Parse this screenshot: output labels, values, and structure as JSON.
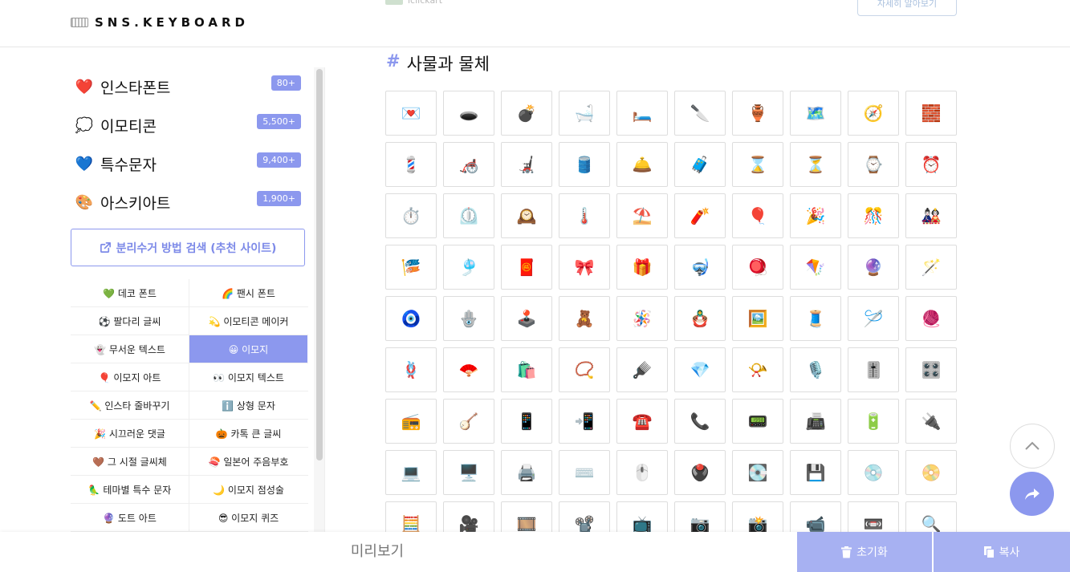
{
  "header": {
    "brand": "SNS.KEYBOARD",
    "ad_name": "lclickart",
    "ad_button": "자세히 알아보기"
  },
  "sidebar": {
    "categories": [
      {
        "icon": "❤️",
        "label": "인스타폰트",
        "count": "80+"
      },
      {
        "icon": "💭",
        "label": "이모티콘",
        "count": "5,500+"
      },
      {
        "icon": "💙",
        "label": "특수문자",
        "count": "9,400+"
      },
      {
        "icon": "🎨",
        "label": "아스키아트",
        "count": "1,900+"
      }
    ],
    "search_site": "분리수거 방법 검색 (추천 사이트)",
    "links": [
      [
        "💚 데코 폰트",
        "🌈 팬시 폰트"
      ],
      [
        "⚽ 팔다리 글씨",
        "💫 이모티콘 메이커"
      ],
      [
        "👻 무서운 텍스트",
        "😀 이모지"
      ],
      [
        "🎈 이모지 아트",
        "👀 이모지 텍스트"
      ],
      [
        "✏️ 인스타 줄바꾸기",
        "ℹ️ 상형 문자"
      ],
      [
        "🎉 시끄러운 댓글",
        "🎃 카톡 큰 글씨"
      ],
      [
        "🤎 그 시절 글씨체",
        "🍣 일본어 주음부호"
      ],
      [
        "🦜 테마별 특수 문자",
        "🌙 이모지 점성술"
      ],
      [
        "🔮 도트 아트",
        "😎 이모지 퀴즈"
      ]
    ]
  },
  "main": {
    "section_title": "사물과 물체",
    "emojis": [
      "💌",
      "🕳️",
      "💣",
      "🛁",
      "🛏️",
      "🔪",
      "🏺",
      "🗺️",
      "🧭",
      "🧱",
      "💈",
      "🦽",
      "🦼",
      "🛢️",
      "🛎️",
      "🧳",
      "⌛",
      "⏳",
      "⌚",
      "⏰",
      "⏱️",
      "⏲️",
      "🕰️",
      "🌡️",
      "⛱️",
      "🧨",
      "🎈",
      "🎉",
      "🎊",
      "🎎",
      "🎏",
      "🎐",
      "🧧",
      "🎀",
      "🎁",
      "🤿",
      "🪀",
      "🪁",
      "🔮",
      "🪄",
      "🧿",
      "🪬",
      "🕹️",
      "🧸",
      "🪅",
      "🪆",
      "🖼️",
      "🧵",
      "🪡",
      "🧶",
      "🪢",
      "🪭",
      "🛍️",
      "📿",
      "🪮",
      "💎",
      "📯",
      "🎙️",
      "🎚️",
      "🎛️",
      "📻",
      "🪕",
      "📱",
      "📲",
      "☎️",
      "📞",
      "📟",
      "📠",
      "🔋",
      "🔌",
      "💻",
      "🖥️",
      "🖨️",
      "⌨️",
      "🖱️",
      "🖲️",
      "💽",
      "💾",
      "💿",
      "📀",
      "🧮",
      "🎥",
      "🎞️",
      "📽️",
      "📺",
      "📷",
      "📸",
      "📹",
      "📼",
      "🔍"
    ]
  },
  "bottom": {
    "preview": "미리보기",
    "reset": "초기화",
    "copy": "복사"
  },
  "active_link": "😀 이모지",
  "colors": {
    "accent": "#8c98ee",
    "button": "#a7b1f2"
  }
}
